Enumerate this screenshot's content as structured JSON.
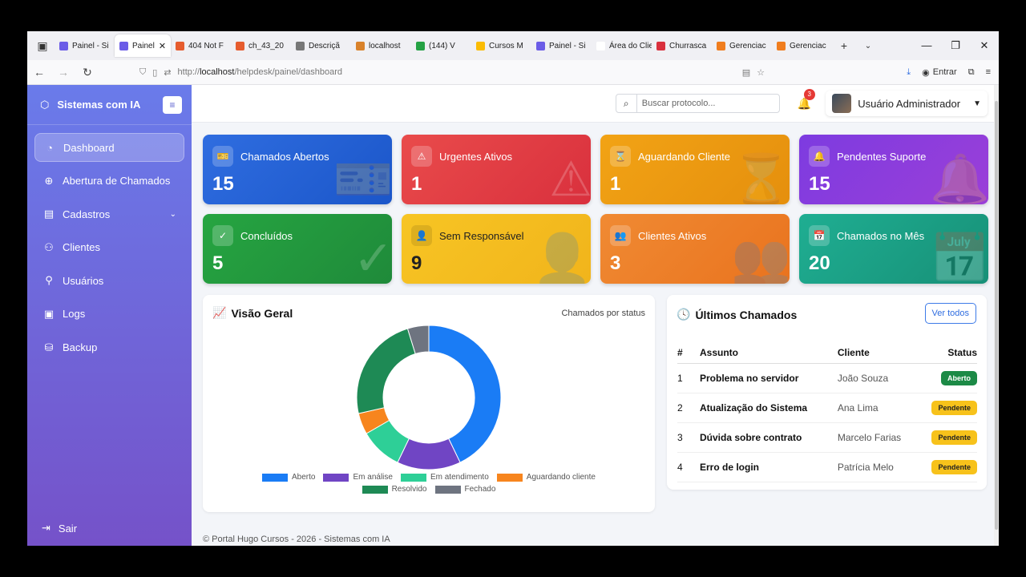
{
  "browser": {
    "tabs": [
      {
        "label": "Painel - Si",
        "color": "#6b5ce7"
      },
      {
        "label": "Painel",
        "color": "#6b5ce7",
        "active": true
      },
      {
        "label": "404 Not F",
        "color": "#e65c2e"
      },
      {
        "label": "ch_43_20",
        "color": "#e65c2e"
      },
      {
        "label": "Descriçã",
        "color": "#777777"
      },
      {
        "label": "localhost",
        "color": "#d9822b"
      },
      {
        "label": "(144) V",
        "color": "#25a244"
      },
      {
        "label": "Cursos M",
        "color": "#fbbc04"
      },
      {
        "label": "Painel - Si",
        "color": "#6b5ce7"
      },
      {
        "label": "Área do Clien",
        "color": "#ffffff"
      },
      {
        "label": "Churrasca",
        "color": "#d9303d"
      },
      {
        "label": "Gerenciac",
        "color": "#f07d1e"
      },
      {
        "label": "Gerenciac",
        "color": "#f07d1e"
      }
    ],
    "url_prefix": "http://",
    "url_host": "localhost",
    "url_path": "/helpdesk/painel/dashboard",
    "signin_label": "Entrar"
  },
  "sidebar": {
    "brand": "Sistemas com IA",
    "items": [
      {
        "label": "Dashboard",
        "icon": "dashboard-icon",
        "active": true
      },
      {
        "label": "Abertura de Chamados",
        "icon": "plus-circle-icon"
      },
      {
        "label": "Cadastros",
        "icon": "list-icon",
        "chevron": true
      },
      {
        "label": "Clientes",
        "icon": "people-icon"
      },
      {
        "label": "Usuários",
        "icon": "user-icon"
      },
      {
        "label": "Logs",
        "icon": "log-icon"
      },
      {
        "label": "Backup",
        "icon": "database-icon"
      }
    ],
    "logout_label": "Sair"
  },
  "topbar": {
    "search_placeholder": "Buscar protocolo...",
    "notification_count": "3",
    "user_name": "Usuário Administrador"
  },
  "cards": [
    {
      "title": "Chamados Abertos",
      "value": "15",
      "style": "c-blue",
      "icon": "ticket-icon",
      "glyph": "🎫"
    },
    {
      "title": "Urgentes Ativos",
      "value": "1",
      "style": "c-red",
      "icon": "warning-icon",
      "glyph": "⚠"
    },
    {
      "title": "Aguardando Cliente",
      "value": "1",
      "style": "c-orange",
      "icon": "hourglass-icon",
      "glyph": "⌛"
    },
    {
      "title": "Pendentes Suporte",
      "value": "15",
      "style": "c-purple",
      "icon": "bell-icon",
      "glyph": "🔔"
    },
    {
      "title": "Concluídos",
      "value": "5",
      "style": "c-green",
      "icon": "check-circle-icon",
      "glyph": "✓"
    },
    {
      "title": "Sem Responsável",
      "value": "9",
      "style": "c-yellow",
      "icon": "user-x-icon",
      "glyph": "👤"
    },
    {
      "title": "Clientes Ativos",
      "value": "3",
      "style": "c-dorange",
      "icon": "people-icon",
      "glyph": "👥"
    },
    {
      "title": "Chamados no Mês",
      "value": "20",
      "style": "c-teal",
      "icon": "calendar-icon",
      "glyph": "📅"
    }
  ],
  "overview": {
    "title": "Visão Geral",
    "subtitle": "Chamados por status"
  },
  "chart_data": {
    "type": "pie",
    "variant": "doughnut",
    "categories": [
      "Aberto",
      "Em análise",
      "Em atendimento",
      "Aguardando cliente",
      "Resolvido",
      "Fechado"
    ],
    "values": [
      9,
      3,
      2,
      1,
      5,
      1
    ],
    "colors": [
      "#1a7cf5",
      "#7045c4",
      "#2ecf97",
      "#f7851e",
      "#1e8a55",
      "#6e7480"
    ],
    "legend_position": "bottom"
  },
  "latest": {
    "title": "Últimos Chamados",
    "button_label": "Ver todos",
    "headers": [
      "#",
      "Assunto",
      "Cliente",
      "Status"
    ],
    "rows": [
      {
        "n": "1",
        "subject": "Problema no servidor",
        "client": "João Souza",
        "status": "Aberto",
        "badge": "b-green"
      },
      {
        "n": "2",
        "subject": "Atualização do Sistema",
        "client": "Ana Lima",
        "status": "Pendente",
        "badge": "b-yellow"
      },
      {
        "n": "3",
        "subject": "Dúvida sobre contrato",
        "client": "Marcelo Farias",
        "status": "Pendente",
        "badge": "b-yellow"
      },
      {
        "n": "4",
        "subject": "Erro de login",
        "client": "Patrícia Melo",
        "status": "Pendente",
        "badge": "b-yellow"
      }
    ]
  },
  "footer": "© Portal Hugo Cursos - 2026 - Sistemas com IA"
}
